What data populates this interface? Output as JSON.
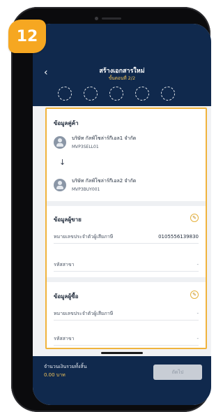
{
  "step_badge": "12",
  "header": {
    "back_icon": "chevron-left-icon",
    "title": "สร้างเอกสารใหม่",
    "step": "ขั้นตอนที่ 2/2"
  },
  "content": {
    "parties": {
      "title": "ข้อมูลคู่ค้า",
      "seller": {
        "name": "บริษัท กัลฟ์โซล่าร์กีเอล1 จำกัด",
        "code": "MVP3SELL01"
      },
      "buyer": {
        "name": "บริษัท กัลฟ์โซล่าร์กีเอล2 จำกัด",
        "code": "MVP3BUY001"
      }
    },
    "seller_info": {
      "title": "ข้อมูลผู้ขาย",
      "tax_label": "หมายเลขประจำตัวผู้เสียภาษี",
      "tax_value": "0105556139830",
      "branch_label": "รหัสสาขา",
      "branch_value": "-"
    },
    "buyer_info": {
      "title": "ข้อมูลผู้ซื้อ",
      "tax_label": "หมายเลขประจำตัวผู้เสียภาษี",
      "tax_value": "-",
      "branch_label": "รหัสสาขา",
      "branch_value": "-"
    }
  },
  "footer": {
    "total_label": "จำนวนเงินรวมทั้งสิ้น",
    "total_value": "0.00 บาท",
    "next_label": "ถัดไป"
  },
  "colors": {
    "navy": "#10294d",
    "accent": "#f6a721",
    "highlight_border": "#f0b33c"
  }
}
